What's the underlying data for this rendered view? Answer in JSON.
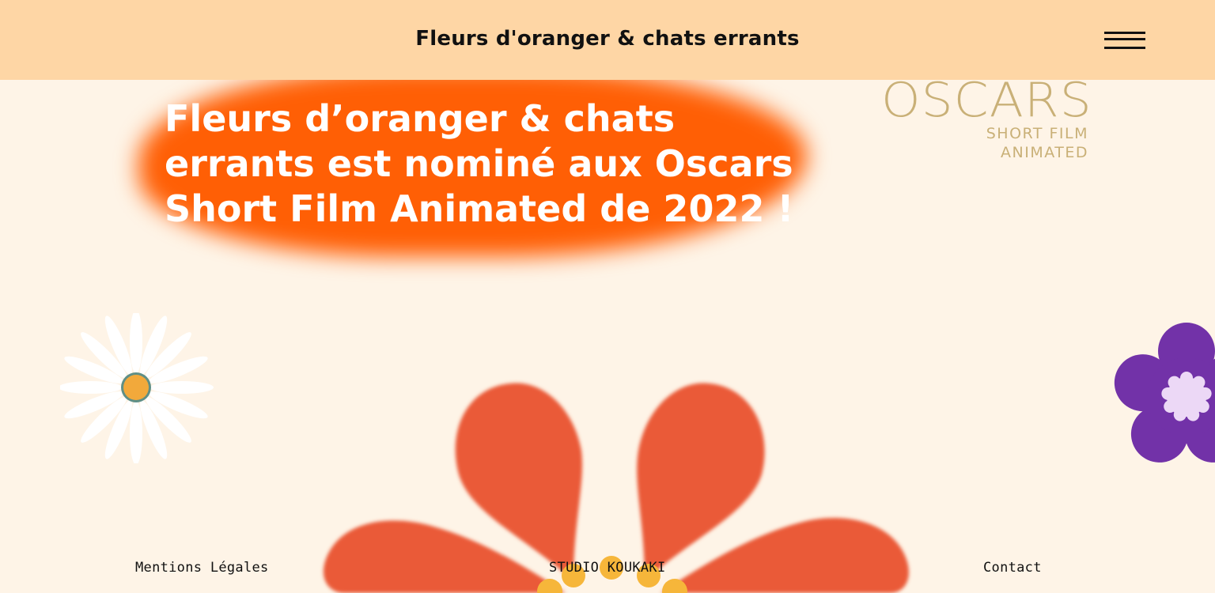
{
  "header": {
    "title": "Fleurs d'oranger & chats errants"
  },
  "hero": {
    "headline": "Fleurs d’oranger & chats errants est nominé aux Oscars Short Film Animated de 2022 !"
  },
  "oscars_logo": {
    "word": "OSCARS",
    "line1": "SHORT FILM",
    "line2": "ANIMATED"
  },
  "footer": {
    "legal": "Mentions Légales",
    "studio": "STUDIO KOUKAKI",
    "contact": "Contact"
  },
  "colors": {
    "header_bg": "#fed6a5",
    "page_bg": "#fef4e7",
    "blob": "#ff5f05",
    "oscars_gold": "#c9b077",
    "big_flower": "#ea5a38",
    "violet_flower": "#7232a8"
  }
}
